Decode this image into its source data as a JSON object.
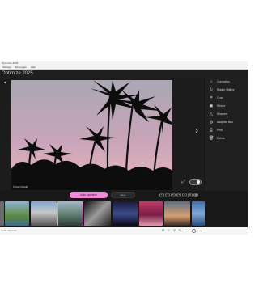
{
  "window": {
    "title": "Optimizer 2025"
  },
  "menu": {
    "items": [
      "Settings",
      "MyImages",
      "Help"
    ]
  },
  "header": {
    "title": "Optimize 2025"
  },
  "photo": {
    "caption": "© Kristin Schultz"
  },
  "panel": {
    "tools": [
      {
        "label": "Correction",
        "icon": "sun-icon"
      },
      {
        "label": "Rotate / Mirror",
        "icon": "rotate-icon"
      },
      {
        "label": "Crop",
        "icon": "crop-icon"
      },
      {
        "label": "Resize",
        "icon": "resize-icon"
      },
      {
        "label": "Sharpen",
        "icon": "triangle-icon"
      },
      {
        "label": "Adaptive Blur",
        "icon": "blur-icon"
      },
      {
        "label": "Print",
        "icon": "print-icon"
      },
      {
        "label": "Delete",
        "icon": "trash-icon"
      }
    ]
  },
  "bottom": {
    "auto_label": "Auto optimize",
    "mid_label": "Save",
    "status": "1 file selected"
  },
  "colors": {
    "accent": "#f28bd8",
    "bg": "#1c1c1c",
    "status_green": "#2b8a5a"
  }
}
